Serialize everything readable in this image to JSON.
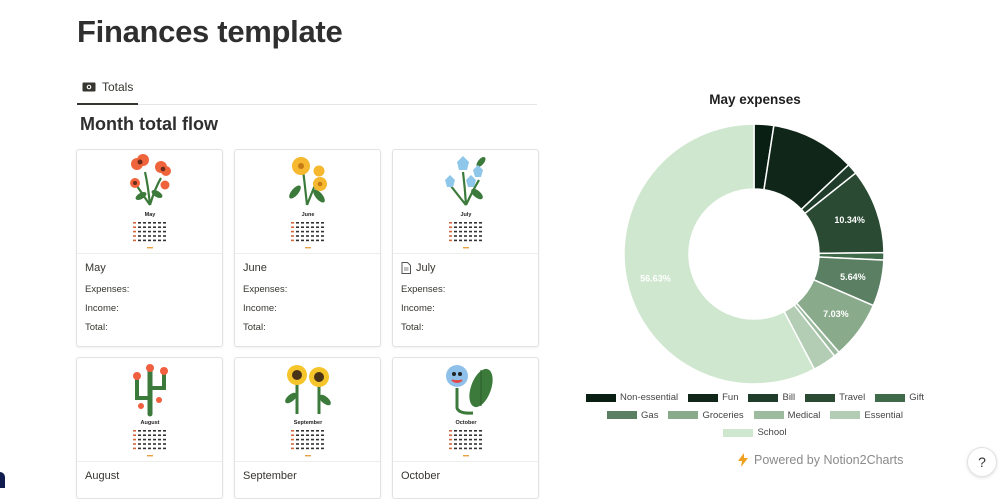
{
  "page": {
    "title": "Finances template"
  },
  "tabs": [
    {
      "label": "Totals",
      "icon": "money-icon"
    }
  ],
  "section": {
    "title": "Month total flow"
  },
  "cards": [
    {
      "name": "May",
      "cal_month": "May",
      "icon": "",
      "expenses_label": "Expenses:",
      "income_label": "Income:",
      "total_label": "Total:",
      "flower": "red-poppies"
    },
    {
      "name": "June",
      "cal_month": "June",
      "icon": "",
      "expenses_label": "Expenses:",
      "income_label": "Income:",
      "total_label": "Total:",
      "flower": "yellow-flowers"
    },
    {
      "name": "July",
      "cal_month": "July",
      "icon": "page-icon",
      "expenses_label": "Expenses:",
      "income_label": "Income:",
      "total_label": "Total:",
      "flower": "blue-bells"
    },
    {
      "name": "August",
      "cal_month": "August",
      "icon": "",
      "flower": "cactus-flowers"
    },
    {
      "name": "September",
      "cal_month": "September",
      "icon": "",
      "flower": "sunflowers"
    },
    {
      "name": "October",
      "cal_month": "October",
      "icon": "",
      "flower": "blue-monster-plant"
    }
  ],
  "chart_data": {
    "type": "pie",
    "title": "May expenses",
    "donut": true,
    "legend_position": "bottom",
    "series": [
      {
        "name": "Non-essential",
        "value": 2.4,
        "color": "#0a1f14",
        "label": ""
      },
      {
        "name": "Fun",
        "value": 10.34,
        "color": "#0f2619",
        "label": ""
      },
      {
        "name": "Bill",
        "value": 1.3,
        "color": "#1f3d2a",
        "label": ""
      },
      {
        "name": "Travel",
        "value": 10.34,
        "color": "#2a4a33",
        "label": "10.34%"
      },
      {
        "name": "Gift",
        "value": 0.9,
        "color": "#3f6b4a",
        "label": ""
      },
      {
        "name": "Gas",
        "value": 5.64,
        "color": "#5a7f62",
        "label": "5.64%"
      },
      {
        "name": "Groceries",
        "value": 7.03,
        "color": "#89ab8c",
        "label": "7.03%"
      },
      {
        "name": "Medical",
        "value": 0.7,
        "color": "#9dbb9f",
        "label": ""
      },
      {
        "name": "Essential",
        "value": 2.9,
        "color": "#b2cdb3",
        "label": ""
      },
      {
        "name": "School",
        "value": 56.63,
        "color": "#cfe7cf",
        "label": "56.63%"
      }
    ]
  },
  "footer": {
    "powered_by": "Powered by Notion2Charts",
    "help_label": "?"
  }
}
